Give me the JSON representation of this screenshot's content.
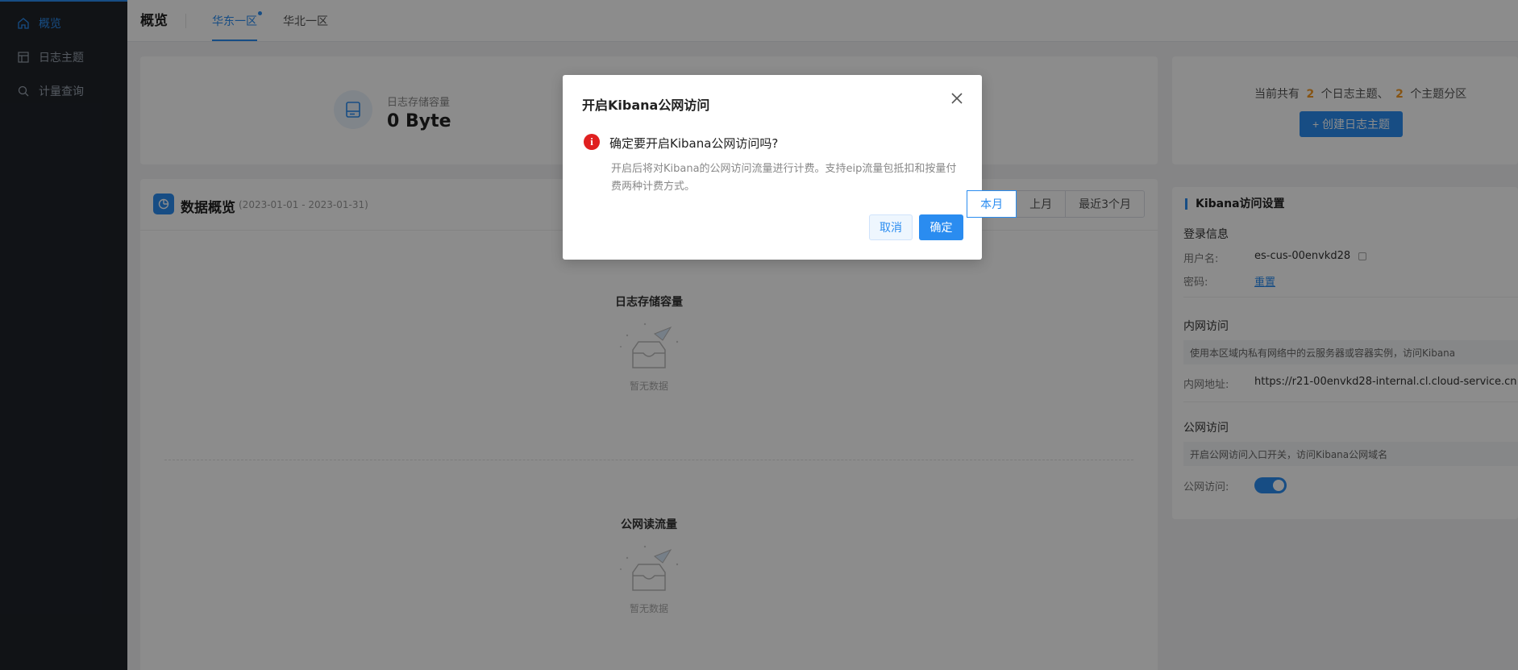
{
  "sidebar": {
    "items": [
      {
        "label": "概览",
        "icon": "home-icon",
        "active": true
      },
      {
        "label": "日志主题",
        "icon": "layout-icon",
        "active": false
      },
      {
        "label": "计量查询",
        "icon": "search-icon",
        "active": false
      }
    ]
  },
  "header": {
    "title": "概览",
    "tabs": [
      {
        "label": "华东一区",
        "active": true
      },
      {
        "label": "华北一区",
        "active": false
      }
    ]
  },
  "storage": {
    "label": "日志存储容量",
    "value": "0 Byte"
  },
  "summary": {
    "prefix": "当前共有",
    "topics_count": "2",
    "topics_suffix": "个日志主题、",
    "partitions_count": "2",
    "partitions_suffix": "个主题分区",
    "create_button": "+ 创建日志主题"
  },
  "overview": {
    "title": "数据概览",
    "range": "(2023-01-01 - 2023-01-31)",
    "periods": [
      {
        "label": "本月",
        "active": true
      },
      {
        "label": "上月",
        "active": false
      },
      {
        "label": "最近3个月",
        "active": false
      }
    ],
    "sections": [
      {
        "title": "日志存储容量",
        "empty": "暂无数据"
      },
      {
        "title": "公网读流量",
        "empty": "暂无数据"
      }
    ]
  },
  "kibana": {
    "title": "Kibana访问设置",
    "login_title": "登录信息",
    "username_label": "用户名:",
    "username_value": "es-cus-00envkd28",
    "password_label": "密码:",
    "password_action": "重置",
    "intranet_title": "内网访问",
    "intranet_note": "使用本区域内私有网络中的云服务器或容器实例，访问Kibana",
    "intranet_addr_label": "内网地址:",
    "intranet_addr_value": "https://r21-00envkd28-internal.cl.cloud-service.cn",
    "public_title": "公网访问",
    "public_note": "开启公网访问入口开关，访问Kibana公网域名",
    "public_label": "公网访问:",
    "public_enabled": true
  },
  "modal": {
    "title": "开启Kibana公网访问",
    "question": "确定要开启Kibana公网访问吗?",
    "description": "开启后将对Kibana的公网访问流量进行计费。支持eip流量包抵扣和按量付费两种计费方式。",
    "cancel_label": "取消",
    "ok_label": "确定"
  },
  "colors": {
    "accent": "#2a8cf0",
    "sidebar_bg": "#1f2329",
    "warning": "#e02020",
    "highlight_number": "#f59a23"
  }
}
